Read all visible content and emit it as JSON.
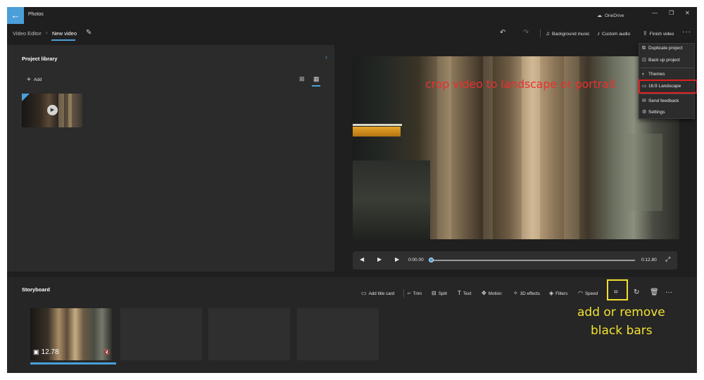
{
  "titlebar": {
    "back_icon": "arrow-left-icon",
    "app_title": "Photos",
    "onedrive_label": "OneDrive",
    "controls": [
      "minimize",
      "restore",
      "close"
    ]
  },
  "header": {
    "breadcrumb_root": "Video Editor",
    "breadcrumb_current": "New video",
    "background_music_label": "Background music",
    "custom_audio_label": "Custom audio",
    "finish_video_label": "Finish video"
  },
  "library": {
    "title": "Project library",
    "add_label": "Add",
    "view_mode": "list"
  },
  "playback": {
    "current_time": "0:00.00",
    "total_time": "0:12.80",
    "progress": 0
  },
  "menu": {
    "items": [
      {
        "label": "Duplicate project",
        "icon": "duplicate-icon"
      },
      {
        "label": "Back up project",
        "icon": "backup-icon"
      },
      {
        "label": "Themes",
        "icon": "palette-icon"
      },
      {
        "label": "16:9 Landscape",
        "icon": "aspect-ratio-icon"
      },
      {
        "label": "Send feedback",
        "icon": "feedback-icon"
      },
      {
        "label": "Settings",
        "icon": "gear-icon"
      }
    ]
  },
  "storyboard": {
    "title": "Storyboard",
    "tools": {
      "add_title_card": "Add title card",
      "trim": "Trim",
      "split": "Split",
      "text": "Text",
      "motion": "Motion",
      "effects_3d": "3D effects",
      "filters": "Filters",
      "speed": "Speed"
    },
    "clips": [
      {
        "duration": "12.78",
        "muted": true
      },
      {
        "empty": true
      },
      {
        "empty": true
      },
      {
        "empty": true
      }
    ]
  },
  "annotations": {
    "red_note": "crop video to landscape or portrait",
    "yellow_note_line1": "add or remove",
    "yellow_note_line2": "black bars",
    "red_color": "#e02020",
    "yellow_color": "#f0e030"
  },
  "colors": {
    "accent": "#4a9fd8",
    "background": "#1f1f1f",
    "panel": "#2b2b2b"
  }
}
